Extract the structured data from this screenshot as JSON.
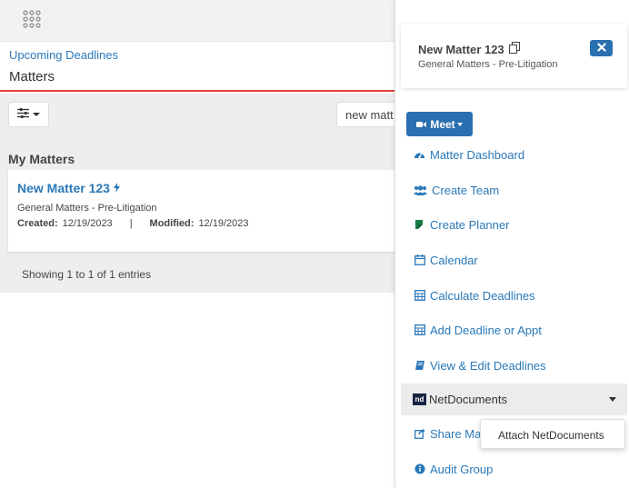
{
  "header": {
    "apps_icon": "grid-dots-icon"
  },
  "breadcrumb": {
    "link": "Upcoming Deadlines",
    "title": "Matters"
  },
  "toolbar": {
    "filter_icon": "sliders-icon",
    "search_value": "new matt"
  },
  "section": {
    "title": "My Matters"
  },
  "matter_card": {
    "title": "New Matter 123",
    "subtitle": "General Matters - Pre-Litigation",
    "created_label": "Created:",
    "created_value": "12/19/2023",
    "separator": "|",
    "modified_label": "Modified:",
    "modified_value": "12/19/2023"
  },
  "table_info": {
    "showing": "Showing 1 to 1 of 1 entries"
  },
  "panel": {
    "title": "New Matter 123",
    "subtitle": "General Matters - Pre-Litigation",
    "meet_label": "Meet",
    "menu": [
      {
        "label": "Matter Dashboard",
        "icon": "dashboard-icon"
      },
      {
        "label": "Create Team",
        "icon": "users-icon"
      },
      {
        "label": "Create Planner",
        "icon": "planner-icon"
      },
      {
        "label": "Calendar",
        "icon": "calendar-icon"
      },
      {
        "label": "Calculate Deadlines",
        "icon": "calculator-icon"
      },
      {
        "label": "Add Deadline or Appt",
        "icon": "calculator-icon"
      },
      {
        "label": "View & Edit Deadlines",
        "icon": "book-icon"
      }
    ],
    "netdocs": {
      "logo": "nd",
      "label": "NetDocuments"
    },
    "share_label": "Share Ma",
    "audit_label": "Audit Group",
    "dropdown_item": "Attach NetDocuments"
  },
  "colors": {
    "link": "#2a78b8",
    "primary": "#2a6fb0",
    "accent_line": "#e0433a"
  }
}
